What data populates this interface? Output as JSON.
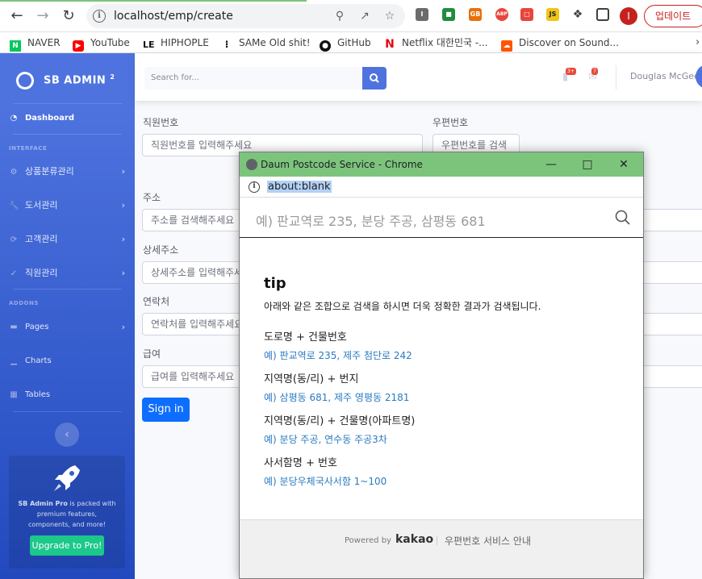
{
  "browser": {
    "url": "localhost/emp/create",
    "update_label": "업데이트",
    "profile_initial": "I",
    "extensions": [
      "ext-i",
      "ext-meet",
      "ext-gb",
      "ABP",
      "ext-chat",
      "JS"
    ],
    "bookmarks": [
      {
        "label": "NAVER",
        "icon": "naver-icon"
      },
      {
        "label": "YouTube",
        "icon": "youtube-icon"
      },
      {
        "label": "HIPHOPLE",
        "icon": "hiphople-icon"
      },
      {
        "label": "SAMe Old shit!",
        "icon": "dots-icon"
      },
      {
        "label": "GitHub",
        "icon": "github-icon"
      },
      {
        "label": "Netflix 대한민국 -...",
        "icon": "netflix-icon"
      },
      {
        "label": "Discover on Sound...",
        "icon": "soundcloud-icon"
      }
    ]
  },
  "sidebar": {
    "brand": "SB ADMIN",
    "brand_sup": "2",
    "dashboard": "Dashboard",
    "interface_heading": "INTERFACE",
    "addons_heading": "ADDONS",
    "items": [
      {
        "label": "상품분류관리"
      },
      {
        "label": "도서관리"
      },
      {
        "label": "고객관리"
      },
      {
        "label": "직원관리"
      }
    ],
    "addons": [
      {
        "label": "Pages"
      },
      {
        "label": "Charts"
      },
      {
        "label": "Tables"
      }
    ],
    "promo_text_bold": "SB Admin Pro",
    "promo_text": " is packed with premium features, components, and more!",
    "promo_button": "Upgrade to Pro!"
  },
  "topbar": {
    "search_placeholder": "Search for...",
    "alerts_badge": "3+",
    "messages_badge": "7",
    "user_name": "Douglas McGee"
  },
  "form": {
    "emp_no_label": "직원번호",
    "emp_no_placeholder": "직원번호를 입력해주세요",
    "zip_label": "우편번호",
    "zip_button": "우편번호를 검색",
    "address_label": "주소",
    "address_placeholder": "주소를 검색해주세요",
    "detail_label": "상세주소",
    "detail_placeholder": "상세주소를 입력해주세요",
    "phone_label": "연락처",
    "phone_placeholder": "연락처를 입력해주세요",
    "salary_label": "급여",
    "salary_placeholder": "급여를 입력해주세요",
    "submit": "Sign in"
  },
  "popup": {
    "title": "Daum Postcode Service - Chrome",
    "url": "about:blank",
    "search_placeholder": "예) 판교역로 235, 분당 주공, 삼평동 681",
    "tip_title": "tip",
    "tip_desc": "아래와 같은 조합으로 검색을 하시면 더욱 정확한 결과가 검색됩니다.",
    "tips": [
      {
        "heading": "도로명 + 건물번호",
        "example": "예) 판교역로 235,  제주 첨단로 242"
      },
      {
        "heading": "지역명(동/리) + 번지",
        "example": "예) 삼평동 681,  제주 영평동 2181"
      },
      {
        "heading": "지역명(동/리) + 건물명(아파트명)",
        "example": "예) 분당 주공,  연수동 주공3차"
      },
      {
        "heading": "사서함명 + 번호",
        "example": "예) 분당우체국사서함 1~100"
      }
    ],
    "powered_by": "Powered by",
    "kakao": "kakao",
    "guide": "우편번호 서비스 안내"
  }
}
